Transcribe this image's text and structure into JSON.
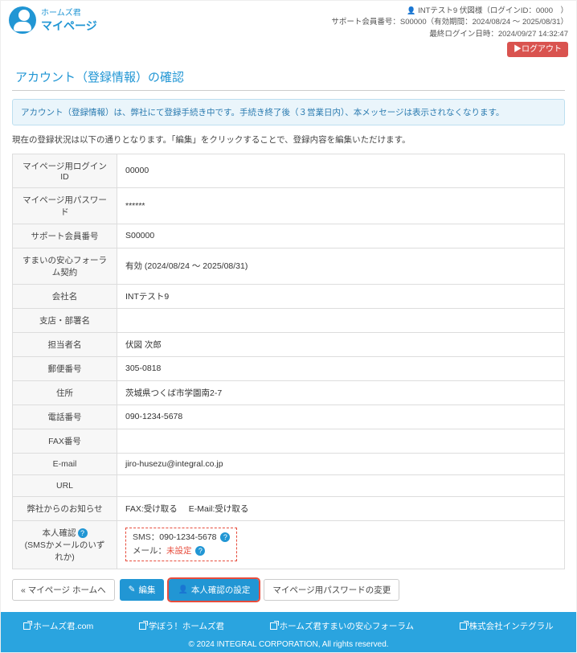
{
  "header": {
    "brand_name": "ホームズ君",
    "brand_sub": "マイページ",
    "user_line": "INTテスト9 伏図様（ログインID：0000　）",
    "support_line": "サポート会員番号：S00000（有効期間：2024/08/24 ～ 2025/08/31）",
    "login_line": "最終ログイン日時：2024/09/27 14:32:47",
    "logout": "▶ログアウト"
  },
  "section_title": "アカウント（登録情報）の確認",
  "banner": "アカウント（登録情報）は、弊社にて登録手続き中です。手続き終了後（３営業日内）、本メッセージは表示されなくなります。",
  "note": "現在の登録状況は以下の通りとなります。「編集」をクリックすることで、登録内容を編集いただけます。",
  "rows": {
    "login_id": {
      "label": "マイページ用ログインID",
      "value": "00000"
    },
    "password": {
      "label": "マイページ用パスワード",
      "value": "******"
    },
    "support_no": {
      "label": "サポート会員番号",
      "value": "S00000"
    },
    "forum": {
      "label": "すまいの安心フォーラム契約",
      "value": "有効 (2024/08/24 ～ 2025/08/31)"
    },
    "company": {
      "label": "会社名",
      "value": "INTテスト9"
    },
    "branch": {
      "label": "支店・部署名",
      "value": ""
    },
    "person": {
      "label": "担当者名",
      "value": "伏図 次郎"
    },
    "postal": {
      "label": "郵便番号",
      "value": "305-0818"
    },
    "address": {
      "label": "住所",
      "value": "茨城県つくば市学園南2-7"
    },
    "tel": {
      "label": "電話番号",
      "value": "090-1234-5678"
    },
    "fax": {
      "label": "FAX番号",
      "value": ""
    },
    "email": {
      "label": "E-mail",
      "value": "jiro-husezu@integral.co.jp"
    },
    "url": {
      "label": "URL",
      "value": ""
    },
    "notice": {
      "label": "弊社からのお知らせ",
      "fax": "FAX:受け取る",
      "mail": "E-Mail:受け取る"
    },
    "verify": {
      "label_a": "本人確認",
      "label_b": "(SMSかメールのいずれか)",
      "sms_label": "SMS：",
      "sms_value": "090-1234-5678",
      "mail_label": "メール：",
      "mail_value": "未設定"
    }
  },
  "buttons": {
    "back": "« マイページ ホームへ",
    "edit": "編集",
    "verify": "本人確認の設定",
    "pwchange": "マイページ用パスワードの変更"
  },
  "footer": {
    "link1": "ホームズ君.com",
    "link2": "学ぼう！ホームズ君",
    "link3": "ホームズ君すまいの安心フォーラム",
    "link4": "株式会社インテグラル",
    "copy": "© 2024 INTEGRAL CORPORATION, All rights reserved."
  }
}
